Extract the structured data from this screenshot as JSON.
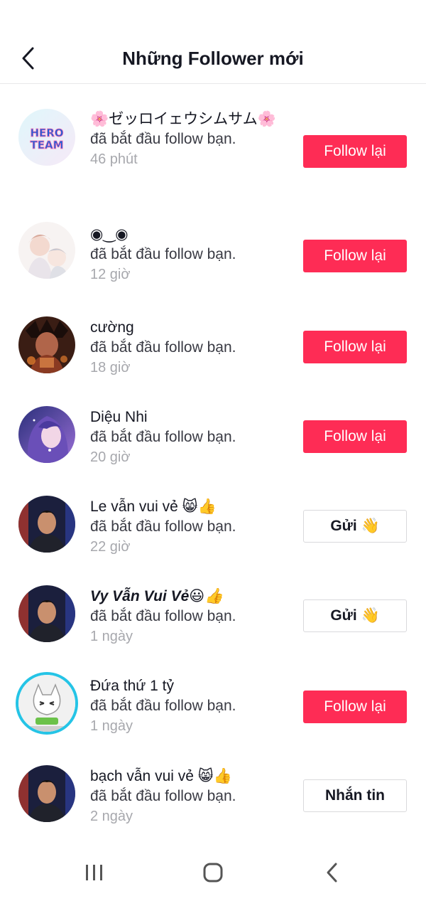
{
  "header": {
    "title": "Những Follower mới"
  },
  "colors": {
    "accent": "#fe2c55",
    "ring": "#25c4e6",
    "secondary_text": "#a7a8ad"
  },
  "followers": [
    {
      "name": "🌸ゼッロイェウシムサム🌸",
      "action": "đã bắt đầu follow bạn.",
      "time": "46 phút",
      "button": "Follow lại",
      "button_style": "primary",
      "avatar_icon": "hero-team-logo-icon"
    },
    {
      "name": "◉‿◉",
      "action": "đã bắt đầu follow bạn.",
      "time": "12 giờ",
      "button": "Follow lại",
      "button_style": "primary",
      "avatar_icon": "anime-couple-icon"
    },
    {
      "name": "cường",
      "action": "đã bắt đầu follow bạn.",
      "time": "18 giờ",
      "button": "Follow lại",
      "button_style": "primary",
      "avatar_icon": "dark-warrior-icon"
    },
    {
      "name": "Diệu Nhi",
      "action": "đã bắt đầu follow bạn.",
      "time": "20 giờ",
      "button": "Follow lại",
      "button_style": "primary",
      "avatar_icon": "anime-girl-icon"
    },
    {
      "name": "Le vẫn vui vẻ 😸👍",
      "action": "đã bắt đầu follow bạn.",
      "time": "22 giờ",
      "button": "Gửi 👋",
      "button_style": "secondary",
      "avatar_icon": "man-portrait-icon"
    },
    {
      "name": "Vy Vẫn Vui Vẻ😃👍",
      "action": "đã bắt đầu follow bạn.",
      "time": "1 ngày",
      "button": "Gửi 👋",
      "button_style": "secondary",
      "avatar_icon": "man-portrait-icon"
    },
    {
      "name": "Đứa thứ 1 tỷ",
      "action": "đã bắt đầu follow bạn.",
      "time": "1 ngày",
      "button": "Follow lại",
      "button_style": "primary",
      "avatar_icon": "cartoon-cat-icon"
    },
    {
      "name": "bạch vẫn vui vẻ 😸👍",
      "action": "đã bắt đầu follow bạn.",
      "time": "2 ngày",
      "button": "Nhắn tin",
      "button_style": "secondary",
      "avatar_icon": "man-portrait-icon"
    }
  ],
  "avatar_text": {
    "hero_line1": "HERO",
    "hero_line2": "TEAM"
  },
  "navbar": {
    "items": [
      "recent-apps-icon",
      "home-icon",
      "back-icon"
    ]
  }
}
